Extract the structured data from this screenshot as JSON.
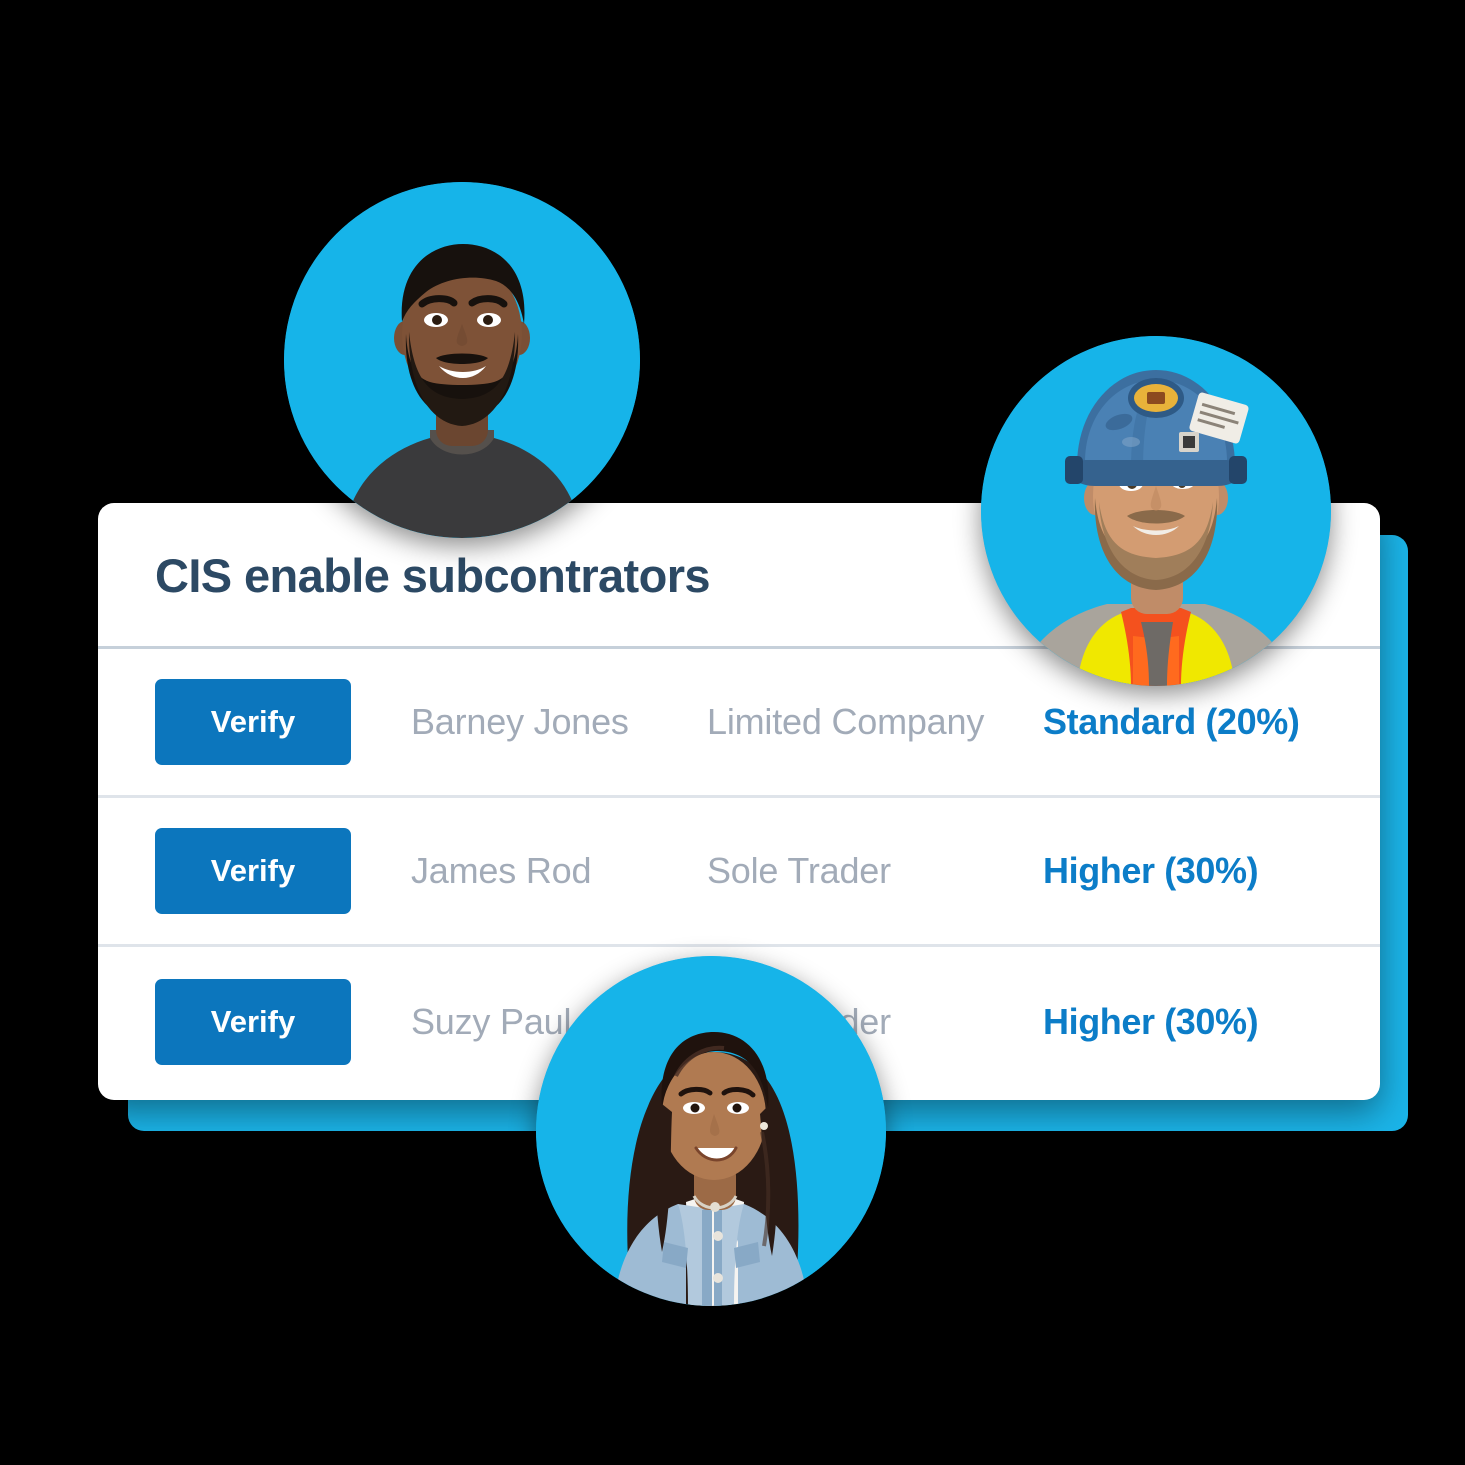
{
  "card": {
    "title": "CIS enable subcontrators"
  },
  "table": {
    "rows": [
      {
        "action_label": "Verify",
        "name": "Barney Jones",
        "business_type": "Limited Company",
        "rate": "Standard (20%)"
      },
      {
        "action_label": "Verify",
        "name": "James Rod",
        "business_type": "Sole Trader",
        "rate": "Higher (30%)"
      },
      {
        "action_label": "Verify",
        "name": "Suzy Paul",
        "business_type": "Sole Trader",
        "rate": "Higher (30%)"
      }
    ]
  },
  "avatars": [
    {
      "id": "avatar-1",
      "description": "smiling-bearded-man-dark-tshirt"
    },
    {
      "id": "avatar-2",
      "description": "construction-worker-blue-hardhat-hi-vis-vest"
    },
    {
      "id": "avatar-3",
      "description": "smiling-woman-long-dark-hair-denim-jacket"
    }
  ],
  "colors": {
    "brand_cyan": "#16B4E9",
    "button_blue": "#0C76BD",
    "rate_blue": "#0C7DC8",
    "title_navy": "#2C4964",
    "muted_text": "#A2ABB8",
    "divider": "#DFE4EA",
    "background": "#000000"
  }
}
